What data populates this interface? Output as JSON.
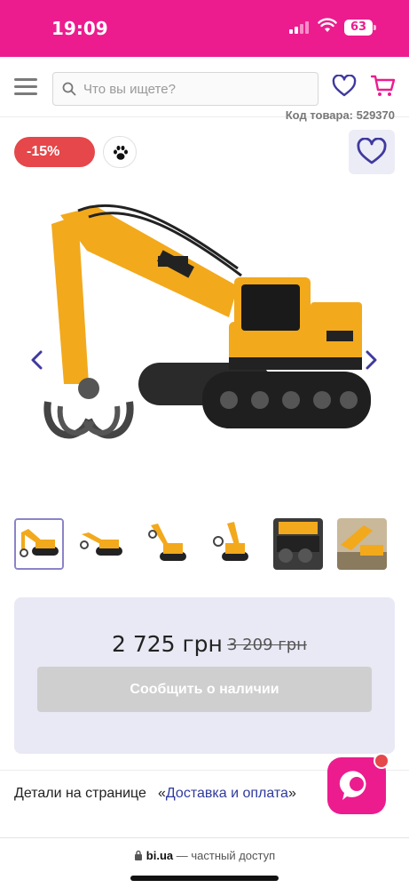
{
  "status_bar": {
    "time": "19:09",
    "battery": "63"
  },
  "header": {
    "search_placeholder": "Что вы ищете?"
  },
  "product": {
    "sku_label": "Код товара: 529370",
    "discount_badge": "-15%",
    "current_price": "2 725 грн",
    "old_price": "3 209 грн",
    "notify_label": "Сообщить о наличии",
    "thumbnail_count": 6,
    "selected_thumbnail": 1
  },
  "details": {
    "label": "Детали на странице",
    "link_open_quote": "«",
    "link_text": "Доставка и оплата",
    "link_close_quote": "»"
  },
  "browser": {
    "domain": "bi.ua",
    "suffix": " — частный доступ"
  },
  "colors": {
    "brand_pink": "#ec1c8e",
    "discount_red": "#e5474a",
    "accent_indigo": "#3f3a9e",
    "price_panel_bg": "#e9e9f5"
  },
  "icons": [
    "menu-icon",
    "search-icon",
    "heart-icon",
    "cart-icon",
    "paw-icon",
    "chevron-left-icon",
    "chevron-right-icon",
    "chat-icon",
    "lock-icon"
  ]
}
